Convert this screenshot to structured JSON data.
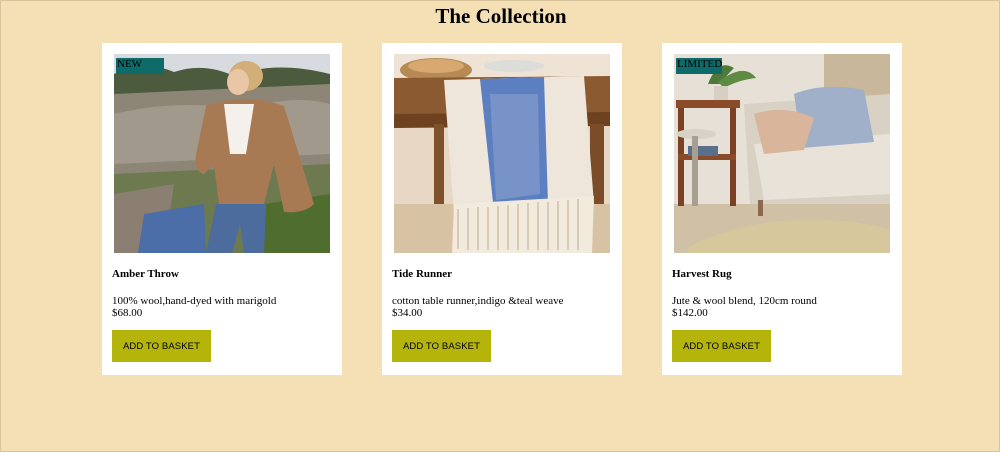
{
  "header": {
    "title": "The Collection"
  },
  "products": [
    {
      "badge": "NEW",
      "name": "Amber Throw",
      "description": "100% wool,hand-dyed with marigold",
      "price": "$68.00",
      "button_label": "ADD TO BASKET",
      "image_icon": "woman-in-shearling-jacket-photo"
    },
    {
      "badge": "",
      "name": "Tide Runner",
      "description": "cotton table runner,indigo &teal weave",
      "price": "$34.00",
      "button_label": "ADD TO BASKET",
      "image_icon": "table-runner-photo"
    },
    {
      "badge": "LIMITED",
      "name": "Harvest Rug",
      "description": "Jute & wool blend, 120cm round",
      "price": "$142.00",
      "button_label": "ADD TO BASKET",
      "image_icon": "living-room-rug-photo"
    }
  ],
  "colors": {
    "page_background": "#f5dfb5",
    "card_background": "#ffffff",
    "button_background": "#b5b40b",
    "badge_background": "#0f6a6a"
  }
}
